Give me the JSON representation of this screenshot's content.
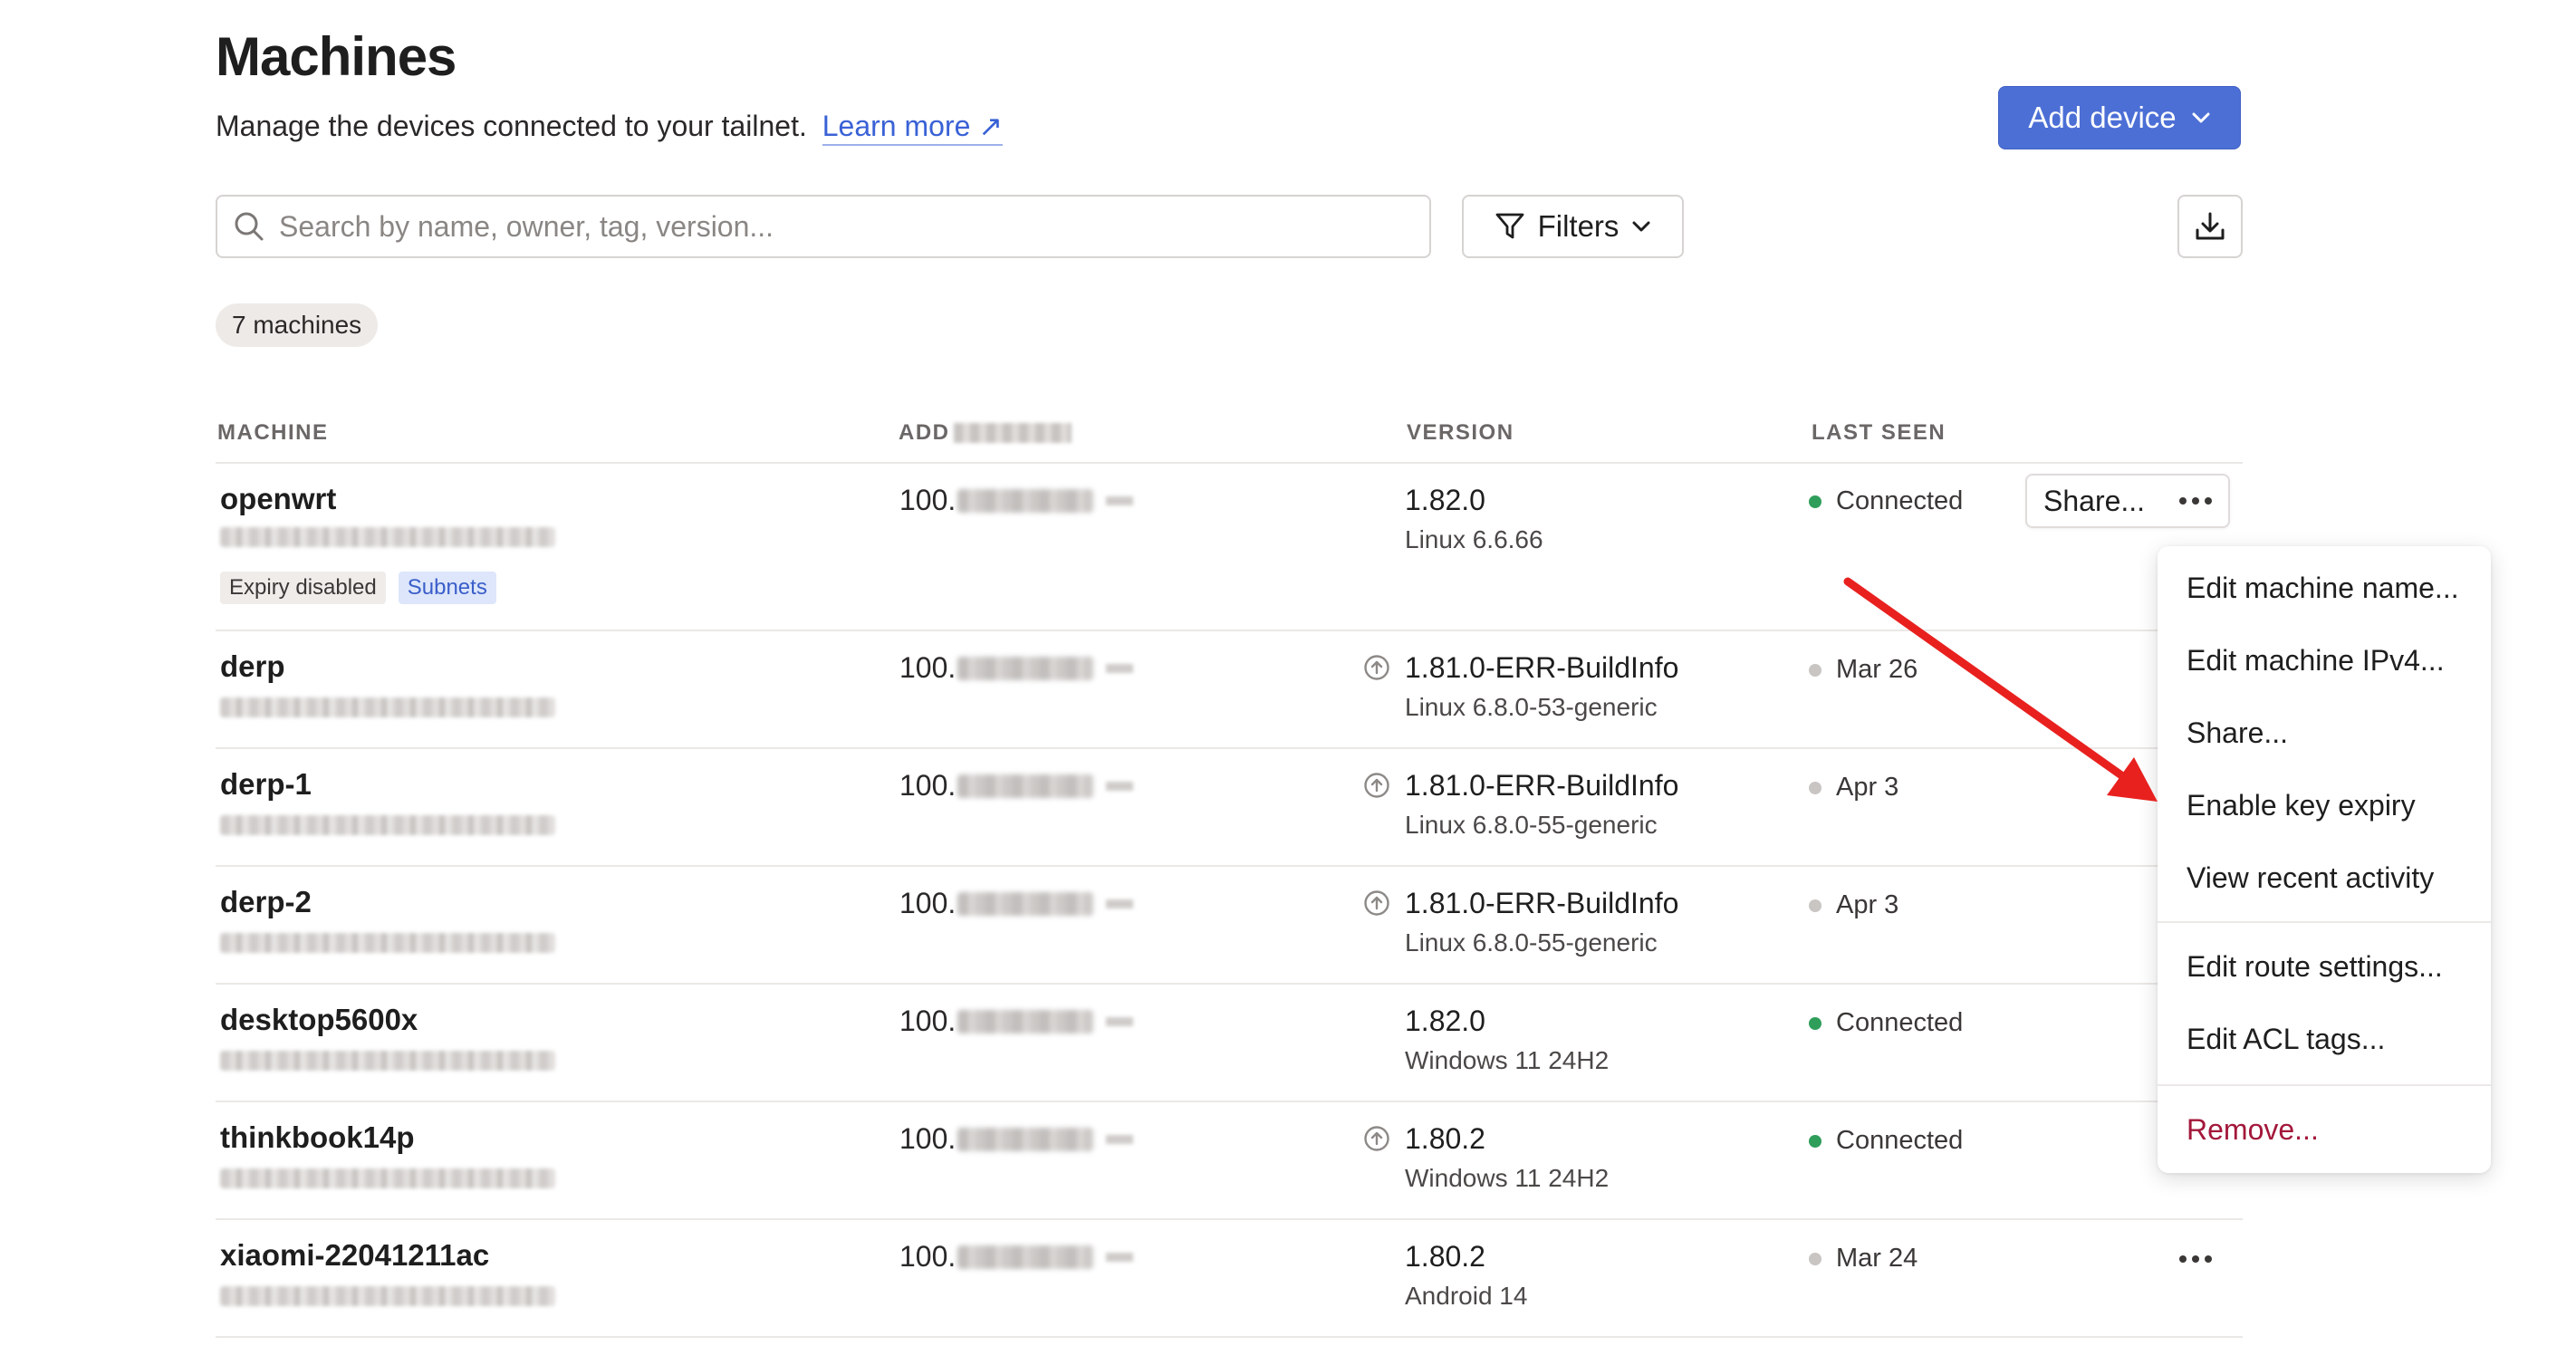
{
  "page": {
    "title": "Machines",
    "subtitle": "Manage the devices connected to your tailnet.",
    "learn_more": "Learn more ↗",
    "add_device": "Add device",
    "search_placeholder": "Search by name, owner, tag, version...",
    "filters": "Filters",
    "count": "7 machines"
  },
  "columns": {
    "machine": "MACHINE",
    "address": "ADD",
    "version": "VERSION",
    "last_seen": "LAST SEEN"
  },
  "machines": [
    {
      "name": "openwrt",
      "ip_prefix": "100.",
      "version": "1.82.0",
      "os": "Linux 6.6.66",
      "update_available": false,
      "last_seen": "Connected",
      "online": true,
      "tags": [
        "Expiry disabled",
        "Subnets"
      ]
    },
    {
      "name": "derp",
      "ip_prefix": "100.",
      "version": "1.81.0-ERR-BuildInfo",
      "os": "Linux 6.8.0-53-generic",
      "update_available": true,
      "last_seen": "Mar 26",
      "online": false
    },
    {
      "name": "derp-1",
      "ip_prefix": "100.",
      "version": "1.81.0-ERR-BuildInfo",
      "os": "Linux 6.8.0-55-generic",
      "update_available": true,
      "last_seen": "Apr 3",
      "online": false
    },
    {
      "name": "derp-2",
      "ip_prefix": "100.",
      "version": "1.81.0-ERR-BuildInfo",
      "os": "Linux 6.8.0-55-generic",
      "update_available": true,
      "last_seen": "Apr 3",
      "online": false
    },
    {
      "name": "desktop5600x",
      "ip_prefix": "100.",
      "version": "1.82.0",
      "os": "Windows 11 24H2",
      "update_available": false,
      "last_seen": "Connected",
      "online": true
    },
    {
      "name": "thinkbook14p",
      "ip_prefix": "100.",
      "version": "1.80.2",
      "os": "Windows 11 24H2",
      "update_available": true,
      "last_seen": "Connected",
      "online": true
    },
    {
      "name": "xiaomi-22041211ac",
      "ip_prefix": "100.",
      "version": "1.80.2",
      "os": "Android 14",
      "update_available": false,
      "last_seen": "Mar 24",
      "online": false
    }
  ],
  "row_actions": {
    "share": "Share..."
  },
  "context_menu": {
    "items": [
      "Edit machine name...",
      "Edit machine IPv4...",
      "Share...",
      "Enable key expiry",
      "View recent activity",
      "Edit route settings...",
      "Edit ACL tags...",
      "Remove..."
    ]
  },
  "colors": {
    "accent": "#4c6fd6",
    "online": "#2f9e5b",
    "danger": "#a3173a",
    "arrow": "#e8211f"
  }
}
